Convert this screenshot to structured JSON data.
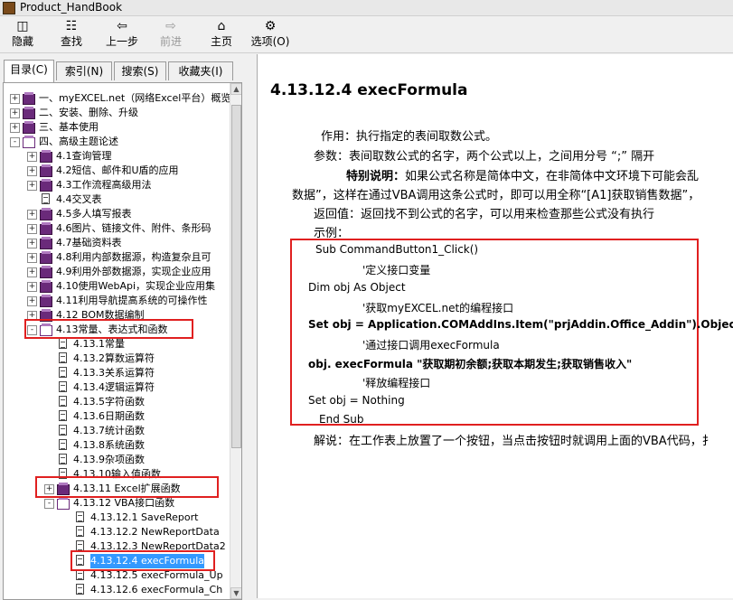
{
  "window": {
    "title": "Product_HandBook"
  },
  "toolbar": {
    "hide": "隐藏",
    "find": "查找",
    "back": "上一步",
    "forward": "前进",
    "home": "主页",
    "options": "选项(O)"
  },
  "tabs": [
    "目录(C)",
    "索引(N)",
    "搜索(S)",
    "收藏夹(I)"
  ],
  "tree": [
    {
      "label": "一、myEXCEL.net（网络Excel平台）概览",
      "exp": "+",
      "icon": "book"
    },
    {
      "label": "二、安装、删除、升级",
      "exp": "+",
      "icon": "book"
    },
    {
      "label": "三、基本使用",
      "exp": "+",
      "icon": "book"
    },
    {
      "label": "四、高级主题论述",
      "exp": "-",
      "icon": "book-open"
    },
    {
      "label": "4.1查询管理",
      "exp": "+",
      "icon": "book"
    },
    {
      "label": "4.2短信、邮件和U盾的应用",
      "exp": "+",
      "icon": "book"
    },
    {
      "label": "4.3工作流程高级用法",
      "exp": "+",
      "icon": "book"
    },
    {
      "label": "4.4交叉表",
      "exp": "",
      "icon": "doc"
    },
    {
      "label": "4.5多人填写报表",
      "exp": "+",
      "icon": "book"
    },
    {
      "label": "4.6图片、链接文件、附件、条形码",
      "exp": "+",
      "icon": "book"
    },
    {
      "label": "4.7基础资料表",
      "exp": "+",
      "icon": "book"
    },
    {
      "label": "4.8利用内部数据源，构造复杂且可",
      "exp": "+",
      "icon": "book"
    },
    {
      "label": "4.9利用外部数据源，实现企业应用",
      "exp": "+",
      "icon": "book"
    },
    {
      "label": "4.10使用WebApi，实现企业应用集",
      "exp": "+",
      "icon": "book"
    },
    {
      "label": "4.11利用导航提高系统的可操作性",
      "exp": "+",
      "icon": "book"
    },
    {
      "label": "4.12 BOM数据编制",
      "exp": "+",
      "icon": "book"
    },
    {
      "label": "4.13常量、表达式和函数",
      "exp": "-",
      "icon": "book-open"
    },
    {
      "label": "4.13.1常量",
      "exp": "",
      "icon": "doc"
    },
    {
      "label": "4.13.2算数运算符",
      "exp": "",
      "icon": "doc"
    },
    {
      "label": "4.13.3关系运算符",
      "exp": "",
      "icon": "doc"
    },
    {
      "label": "4.13.4逻辑运算符",
      "exp": "",
      "icon": "doc"
    },
    {
      "label": "4.13.5字符函数",
      "exp": "",
      "icon": "doc"
    },
    {
      "label": "4.13.6日期函数",
      "exp": "",
      "icon": "doc"
    },
    {
      "label": "4.13.7统计函数",
      "exp": "",
      "icon": "doc"
    },
    {
      "label": "4.13.8系统函数",
      "exp": "",
      "icon": "doc"
    },
    {
      "label": "4.13.9杂项函数",
      "exp": "",
      "icon": "doc"
    },
    {
      "label": "4.13.10输入值函数",
      "exp": "",
      "icon": "doc"
    },
    {
      "label": "4.13.11 Excel扩展函数",
      "exp": "+",
      "icon": "book"
    },
    {
      "label": "4.13.12 VBA接口函数",
      "exp": "-",
      "icon": "book-open"
    },
    {
      "label": "4.13.12.1 SaveReport",
      "exp": "",
      "icon": "doc"
    },
    {
      "label": "4.13.12.2 NewReportData",
      "exp": "",
      "icon": "doc"
    },
    {
      "label": "4.13.12.3 NewReportData2",
      "exp": "",
      "icon": "doc"
    },
    {
      "label": "4.13.12.4 execFormula",
      "exp": "",
      "icon": "doc"
    },
    {
      "label": "4.13.12.5 execFormula_Up",
      "exp": "",
      "icon": "doc"
    },
    {
      "label": "4.13.12.6 execFormula_Ch",
      "exp": "",
      "icon": "doc"
    }
  ],
  "content": {
    "heading": "4.13.12.4 execFormula",
    "purpose": "作用：执行指定的表间取数公式。",
    "param": "参数：表间取数公式的名字，两个公式以上，之间用分号 “;” 隔开",
    "special_label": "特别说明：",
    "special_text": "如果公式名称是简体中文，在非简体中文环境下可能会乱",
    "special_cont": "数据”，这样在通过VBA调用这条公式时，即可以用全称“[A1]获取销售数据”，",
    "returns": "返回值：返回找不到公式的名字，可以用来检查那些公式没有执行",
    "example": "示例：",
    "code": [
      "Sub CommandButton1_Click()",
      "'定义接口变量",
      "Dim obj As Object",
      "'获取myEXCEL.net的编程接口",
      "Set obj = Application.COMAddIns.Item(\"prjAddin.Office_Addin\").Object",
      "'通过接口调用execFormula",
      "obj. execFormula \"获取期初余额;获取本期发生;获取销售收入\"",
      "'释放编程接口",
      "Set obj = Nothing",
      "End Sub"
    ],
    "explain": "解说：在工作表上放置了一个按钮，当点击按钮时就调用上面的VBA代码，扌"
  },
  "colors": {
    "highlight": "#e02020",
    "selection": "#3399ff"
  }
}
